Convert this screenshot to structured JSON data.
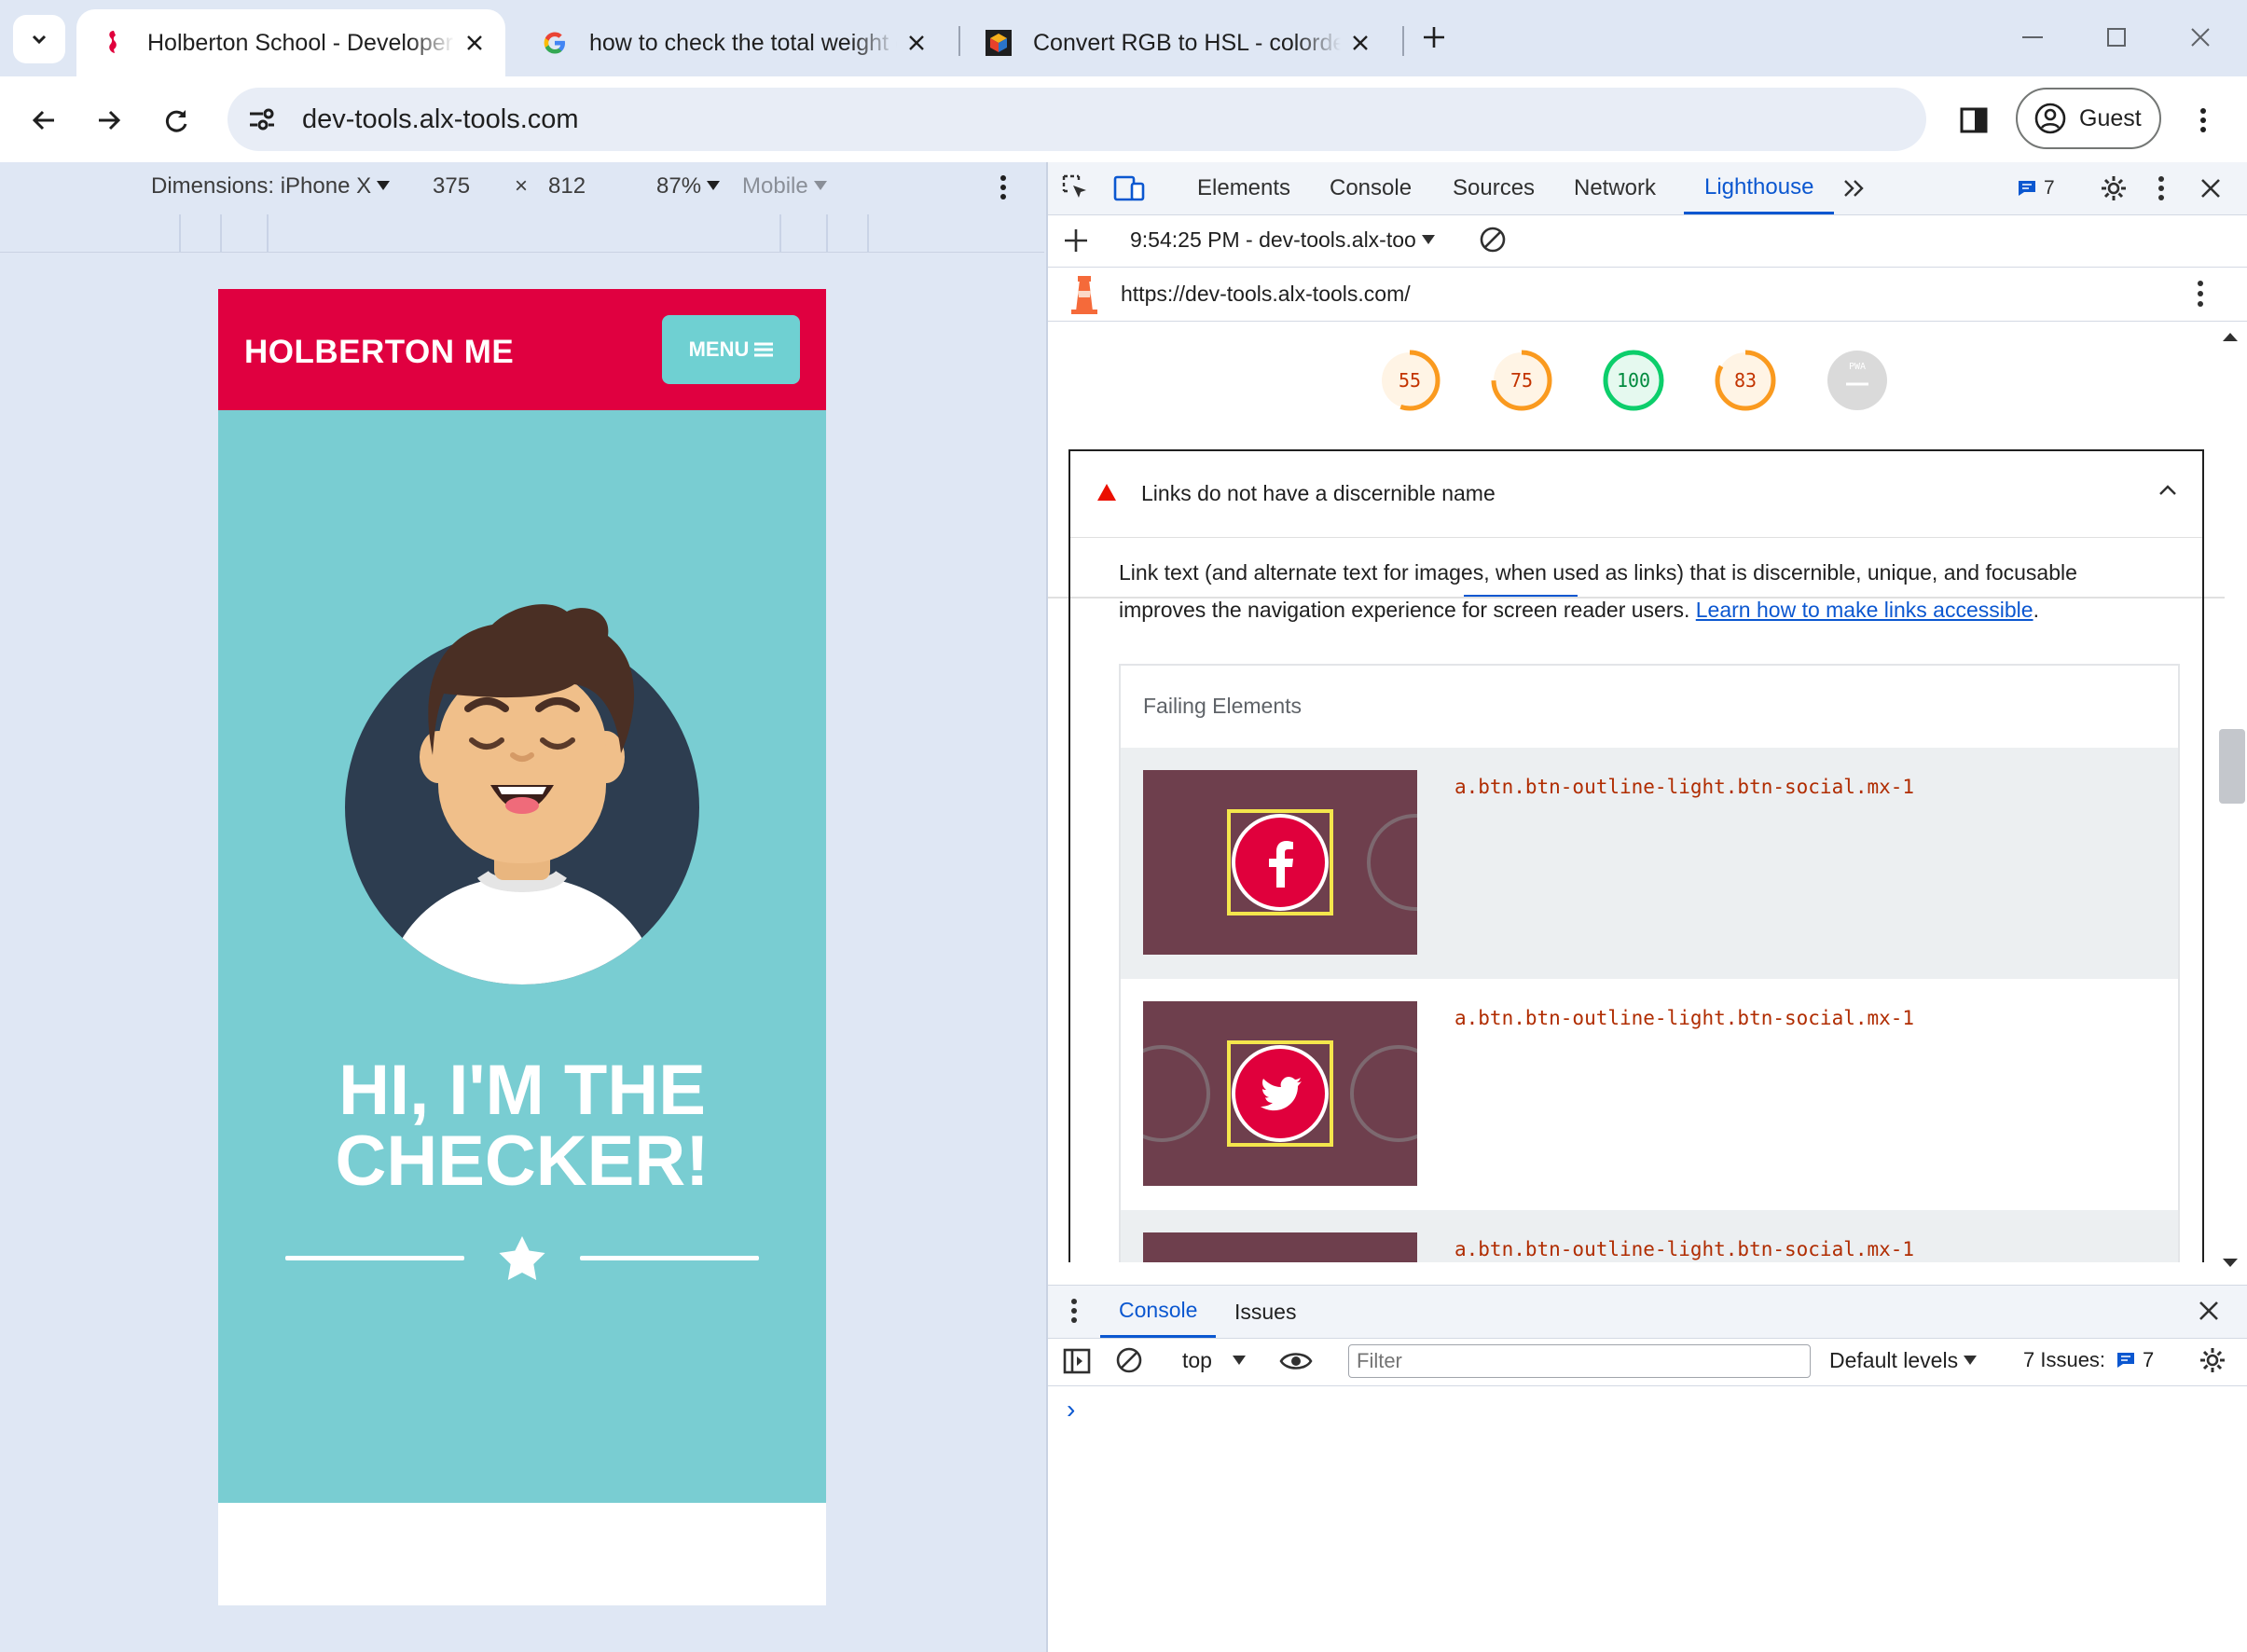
{
  "browser": {
    "tabs": [
      {
        "title": "Holberton School - Developer t",
        "active": true
      },
      {
        "title": "how to check the total weight o",
        "active": false
      },
      {
        "title": "Convert RGB to HSL - colordesig",
        "active": false
      }
    ],
    "url": "dev-tools.alx-tools.com",
    "profile_label": "Guest"
  },
  "device_toolbar": {
    "dimensions_label": "Dimensions: iPhone X",
    "width": "375",
    "times": "×",
    "height": "812",
    "zoom": "87%",
    "mode": "Mobile"
  },
  "page": {
    "brand": "HOLBERTON ME",
    "menu_label": "MENU",
    "hero_title_line1": "HI, I'M THE",
    "hero_title_line2": "CHECKER!",
    "colors": {
      "nav": "#e00040",
      "hero": "#79cdd2",
      "menu_button": "#6fd0d2"
    }
  },
  "devtools": {
    "tabs": [
      "Elements",
      "Console",
      "Sources",
      "Network",
      "Lighthouse"
    ],
    "active_tab": "Lighthouse",
    "issues_count": "7",
    "report_time": "9:54:25 PM - dev-tools.alx-too",
    "report_url": "https://dev-tools.alx-tools.com/",
    "scores": [
      {
        "value": "55",
        "color": "#fa9a1f"
      },
      {
        "value": "75",
        "color": "#fa9a1f"
      },
      {
        "value": "100",
        "color": "#0cce6b"
      },
      {
        "value": "83",
        "color": "#fa9a1f"
      },
      {
        "value": "PWA",
        "color": "#cccccc"
      }
    ],
    "audit": {
      "title": "Links do not have a discernible name",
      "description": "Link text (and alternate text for images, when used as links) that is discernible, unique, and focusable improves the navigation experience for screen reader users.",
      "link_text": "Learn how to make links accessible",
      "failing_header": "Failing Elements",
      "failing_elements": [
        {
          "selector": "a.btn.btn-outline-light.btn-social.mx-1",
          "icon": "facebook-icon"
        },
        {
          "selector": "a.btn.btn-outline-light.btn-social.mx-1",
          "icon": "twitter-icon"
        },
        {
          "selector": "a.btn.btn-outline-light.btn-social.mx-1",
          "icon": "linkedin-icon"
        }
      ]
    },
    "drawer": {
      "tabs": [
        "Console",
        "Issues"
      ],
      "context": "top",
      "filter_placeholder": "Filter",
      "levels": "Default levels",
      "issues_label": "7 Issues:",
      "issues_count": "7",
      "prompt": "›"
    }
  }
}
